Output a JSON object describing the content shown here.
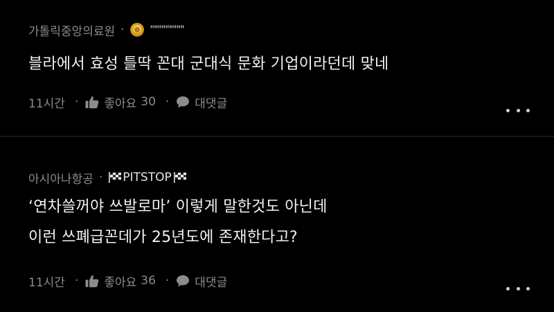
{
  "comments": [
    {
      "author_org": "가톨릭중앙의료원",
      "nickname": "\"\"\"\"\"\"\"\"\"",
      "badge_icon": "gold-medal-icon",
      "lines": [
        "블라에서 효성 틀딱 꼰대 군대식 문화 기업이라던데 맞네"
      ],
      "time": "11시간",
      "like_label": "좋아요",
      "like_count": "30",
      "reply_label": "대댓글"
    },
    {
      "author_org": "아시아나항공",
      "nickname": "PITSTOP",
      "badge_icon": "checkered-flag-icon",
      "lines": [
        "‘연차쓸꺼야 쓰발로마’ 이렇게 말한것도 아닌데",
        "이런 쓰폐급꼰데가 25년도에 존재한다고?"
      ],
      "time": "11시간",
      "like_label": "좋아요",
      "like_count": "36",
      "reply_label": "대댓글"
    }
  ],
  "separator": "·",
  "colors": {
    "background": "#000000",
    "text_primary": "#f2f2f2",
    "text_secondary": "#8c8c8c",
    "divider": "#2a2a2a"
  }
}
